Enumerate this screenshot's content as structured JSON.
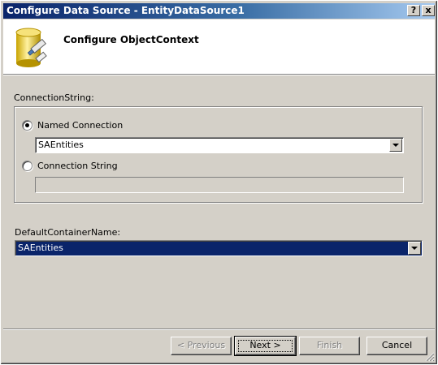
{
  "window": {
    "title": "Configure Data Source - EntityDataSource1",
    "help_glyph": "?",
    "close_glyph": "x"
  },
  "header": {
    "title": "Configure ObjectContext",
    "icon": "database-icon"
  },
  "connection_string": {
    "group_label": "ConnectionString:",
    "named_connection": {
      "label": "Named Connection",
      "selected": true,
      "value": "SAEntities"
    },
    "connection_string_option": {
      "label": "Connection String",
      "selected": false,
      "value": ""
    }
  },
  "default_container": {
    "label": "DefaultContainerName:",
    "value": "SAEntities"
  },
  "buttons": {
    "previous": "< Previous",
    "next": "Next >",
    "finish": "Finish",
    "cancel": "Cancel"
  },
  "colors": {
    "title_bar": "#0a246a",
    "dialog_face": "#d4d0c8",
    "selection": "#0a246a"
  }
}
